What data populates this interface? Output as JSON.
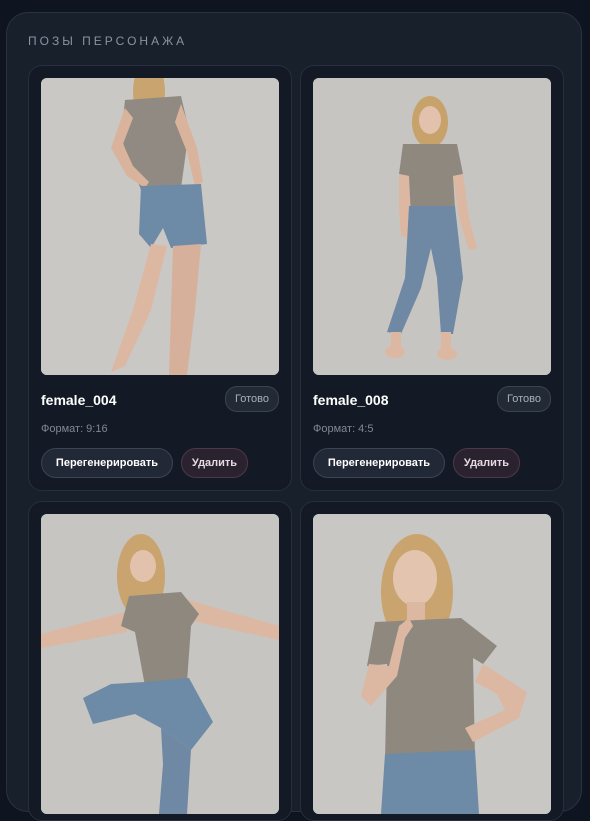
{
  "section": {
    "title": "ПОЗЫ ПЕРСОНАЖА"
  },
  "cards": [
    {
      "name": "female_004",
      "status": "Готово",
      "format": "Формат: 9:16",
      "regenerate_label": "Перегенерировать",
      "delete_label": "Удалить"
    },
    {
      "name": "female_008",
      "status": "Готово",
      "format": "Формат: 4:5",
      "regenerate_label": "Перегенерировать",
      "delete_label": "Удалить"
    },
    {
      "name": "",
      "status": "",
      "format": "",
      "regenerate_label": "",
      "delete_label": ""
    },
    {
      "name": "",
      "status": "",
      "format": "",
      "regenerate_label": "",
      "delete_label": ""
    }
  ],
  "colors": {
    "panel_bg": "#18202c",
    "card_bg": "#131a25",
    "delete_button_bg": "#2b2230"
  }
}
